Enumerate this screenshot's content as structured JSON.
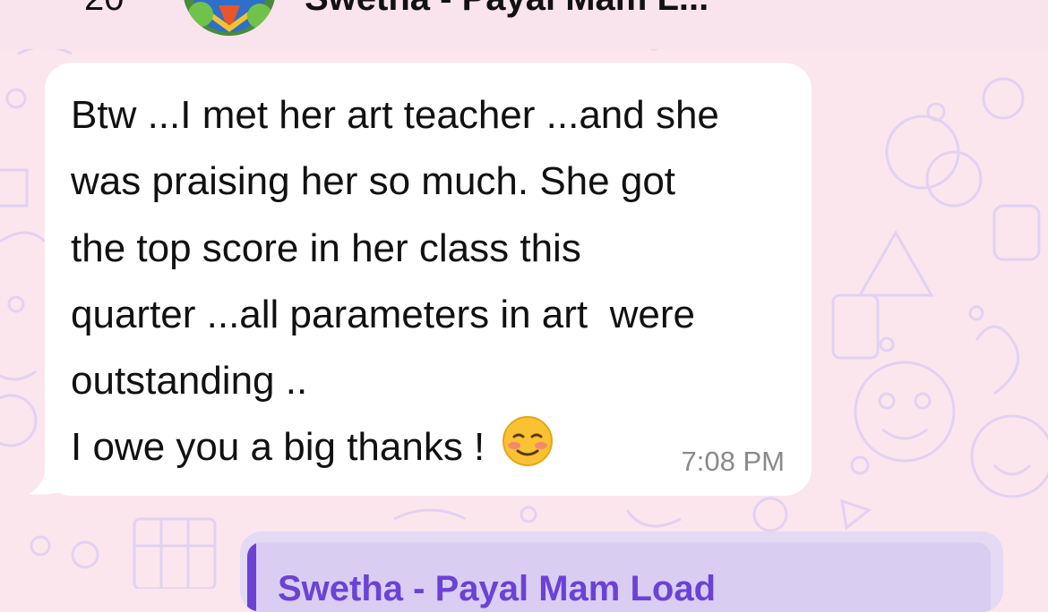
{
  "header": {
    "unread_count": "20",
    "contact_name": "Swetha - Payal Mam L..."
  },
  "message": {
    "text": "Btw ...I met her art teacher ...and she\nwas praising her so much. She got\nthe top score in her class this\nquarter ...all parameters in art  were\noutstanding ..\nI owe you a big thanks ! ",
    "emoji": "smiling-face-with-blush",
    "time": "7:08 PM"
  },
  "reply": {
    "quoted_author": "Swetha - Payal Mam Load"
  },
  "colors": {
    "background": "#fbe6ee",
    "wallpaper_doodle": "#e2d2f0",
    "bubble": "#ffffff",
    "quote_accent": "#6b42d6",
    "reply_bubble": "#e4daf4"
  }
}
